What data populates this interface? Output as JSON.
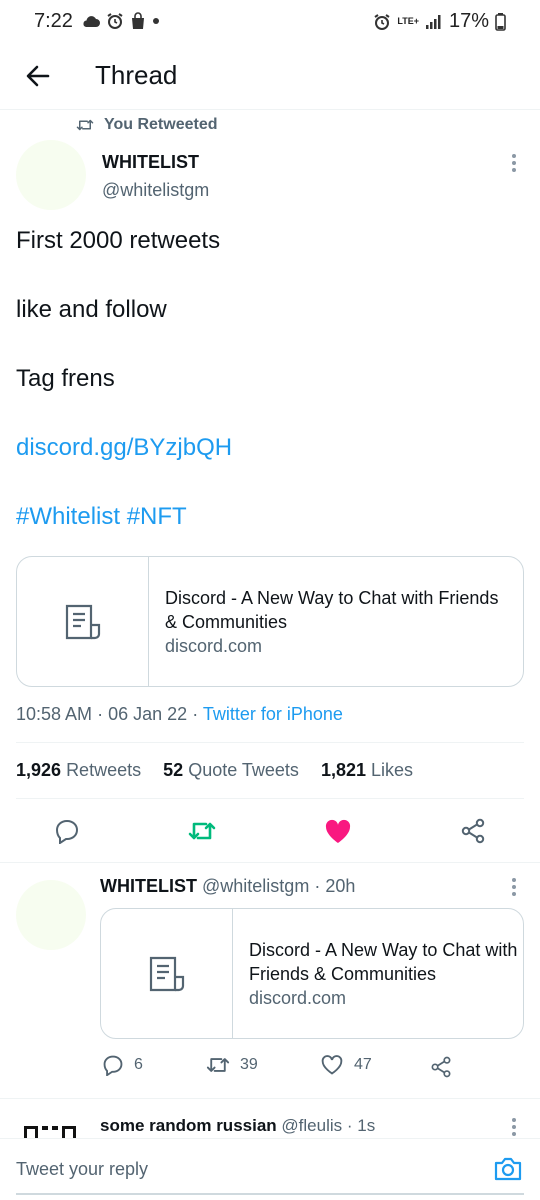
{
  "status_bar": {
    "time": "7:22",
    "network": "LTE+",
    "battery": "17%"
  },
  "header": {
    "title": "Thread"
  },
  "main_tweet": {
    "context": "You Retweeted",
    "author_name": "WHITELIST",
    "author_handle": "@whitelistgm",
    "lines": {
      "line1": "First 2000 retweets",
      "line2": "like and follow",
      "line3": "Tag frens",
      "link": "discord.gg/BYzjbQH",
      "hashtags": "#Whitelist #NFT"
    },
    "card": {
      "title": "Discord - A New Way to Chat with Friends & Communities",
      "domain": "discord.com"
    },
    "meta": {
      "time": "10:58 AM",
      "sep1": "·",
      "date": "06 Jan 22",
      "sep2": "·",
      "source": "Twitter for iPhone"
    },
    "stats": {
      "retweets_count": "1,926",
      "retweets_label": "Retweets",
      "quotes_count": "52",
      "quotes_label": "Quote Tweets",
      "likes_count": "1,821",
      "likes_label": "Likes"
    },
    "colors": {
      "retweet_active": "#00ba7c",
      "like_active": "#f91880"
    }
  },
  "reply_tweet": {
    "author_name": "WHITELIST",
    "author_handle": "@whitelistgm",
    "age": "· 20h",
    "card": {
      "title": "Discord - A New Way to Chat with Friends & Communities",
      "domain": "discord.com"
    },
    "actions": {
      "replies": "6",
      "retweets": "39",
      "likes": "47"
    }
  },
  "next_tweet": {
    "author_name": "some random russian",
    "author_handle": "@fleulis",
    "age": "· 1s"
  },
  "reply_bar": {
    "placeholder": "Tweet your reply"
  },
  "accent_color": "#1d9bf0"
}
